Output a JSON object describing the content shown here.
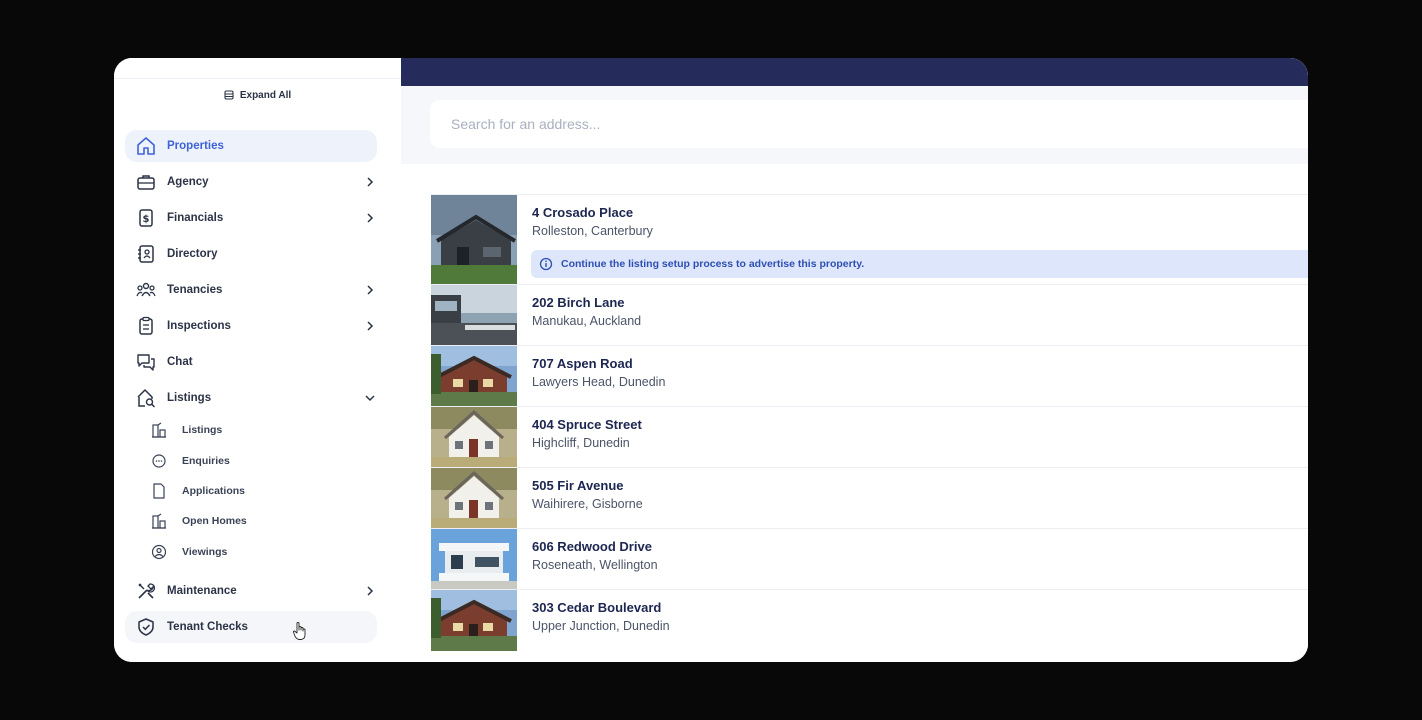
{
  "sidebar": {
    "expand_all": "Expand All",
    "items": [
      {
        "label": "Properties",
        "icon": "home-icon",
        "active": true
      },
      {
        "label": "Agency",
        "icon": "briefcase-icon",
        "chevron": "right"
      },
      {
        "label": "Financials",
        "icon": "dollar-document-icon",
        "chevron": "right"
      },
      {
        "label": "Directory",
        "icon": "address-book-icon"
      },
      {
        "label": "Tenancies",
        "icon": "people-icon",
        "chevron": "right"
      },
      {
        "label": "Inspections",
        "icon": "clipboard-icon",
        "chevron": "right"
      },
      {
        "label": "Chat",
        "icon": "chat-bubbles-icon"
      },
      {
        "label": "Listings",
        "icon": "house-search-icon",
        "chevron": "down"
      },
      {
        "label": "Maintenance",
        "icon": "tools-icon",
        "chevron": "right"
      },
      {
        "label": "Tenant Checks",
        "icon": "shield-check-icon"
      }
    ],
    "listings_sub": [
      {
        "label": "Listings",
        "icon": "building-chart-icon"
      },
      {
        "label": "Enquiries",
        "icon": "speech-bubble-icon"
      },
      {
        "label": "Applications",
        "icon": "file-icon"
      },
      {
        "label": "Open Homes",
        "icon": "building-chart-icon"
      },
      {
        "label": "Viewings",
        "icon": "user-circle-icon"
      }
    ]
  },
  "search": {
    "placeholder": "Search for an address..."
  },
  "properties": [
    {
      "address": "4 Crosado Place",
      "suburb": "Rolleston, Canterbury",
      "notice": "Continue the listing setup process to advertise this property.",
      "thumb": "dark-modern"
    },
    {
      "address": "202 Birch Lane",
      "suburb": "Manukau, Auckland",
      "thumb": "waterfront"
    },
    {
      "address": "707 Aspen Road",
      "suburb": "Lawyers Head, Dunedin",
      "thumb": "brick-bungalow"
    },
    {
      "address": "404 Spruce Street",
      "suburb": "Highcliff, Dunedin",
      "thumb": "white-cottage"
    },
    {
      "address": "505 Fir Avenue",
      "suburb": "Waihirere, Gisborne",
      "thumb": "white-cottage"
    },
    {
      "address": "606 Redwood Drive",
      "suburb": "Roseneath, Wellington",
      "thumb": "modern-white"
    },
    {
      "address": "303 Cedar Boulevard",
      "suburb": "Upper Junction, Dunedin",
      "thumb": "brick-bungalow"
    }
  ],
  "colors": {
    "accent": "#3e63d8",
    "topbar": "#252c5c",
    "notice_bg": "#dde6fb"
  }
}
